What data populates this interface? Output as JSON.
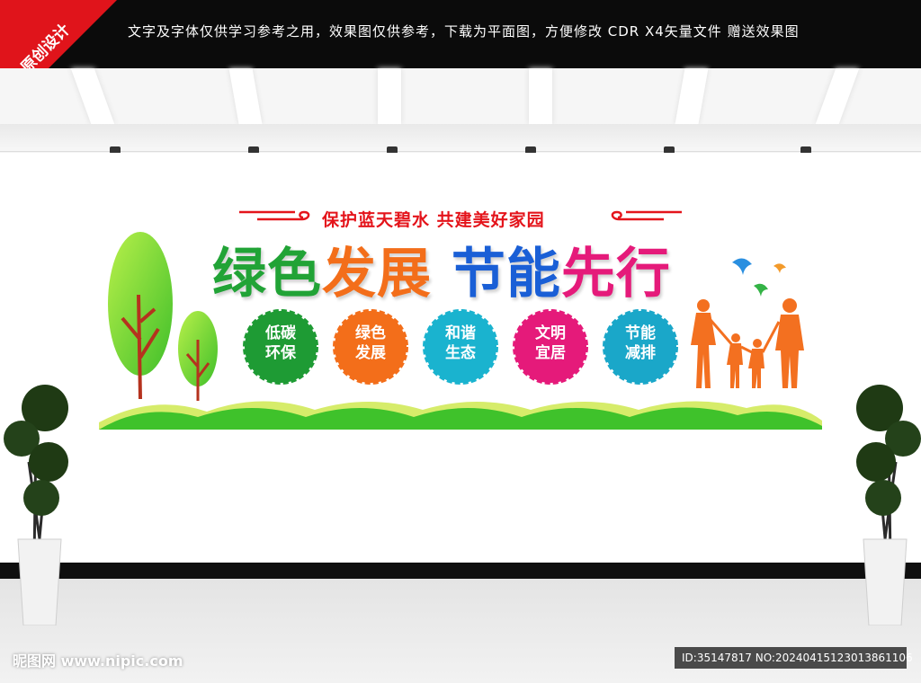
{
  "header": {
    "badge": "原创设计",
    "notice": "文字及字体仅供学习参考之用，效果图仅供参考，下载为平面图，方便修改    CDR X4矢量文件  赠送效果图"
  },
  "slogan": "保护蓝天碧水 共建美好家园",
  "title": {
    "part1": "绿色",
    "part2": "发展",
    "part3": "节能",
    "part4": "先行"
  },
  "badges": [
    {
      "line1": "低碳",
      "line2": "环保",
      "color": "#1e9b34"
    },
    {
      "line1": "绿色",
      "line2": "发展",
      "color": "#f36e1a"
    },
    {
      "line1": "和谐",
      "line2": "生态",
      "color": "#1ab3cf"
    },
    {
      "line1": "文明",
      "line2": "宜居",
      "color": "#e51a7a"
    },
    {
      "line1": "节能",
      "line2": "减排",
      "color": "#1aa7c9"
    }
  ],
  "footer": {
    "watermark": "昵图网 www.nipic.com",
    "id": "ID:35147817 NO:20240415123013861106"
  },
  "colors": {
    "green": "#21a336",
    "orange": "#f36e1a",
    "blue": "#1a5fd6",
    "pink": "#e51a7a",
    "red": "#e4141b"
  }
}
